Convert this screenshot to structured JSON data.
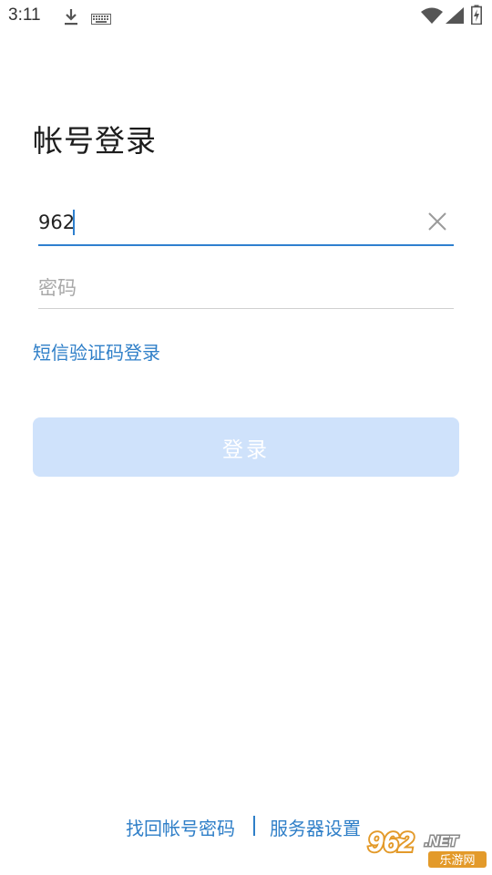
{
  "status_bar": {
    "time": "3:11",
    "icons": [
      "download-icon",
      "keyboard-icon",
      "wifi-icon",
      "signal-icon",
      "battery-charging-icon"
    ]
  },
  "page": {
    "title": "帐号登录"
  },
  "form": {
    "username_value": "962",
    "password_placeholder": "密码",
    "sms_login_label": "短信验证码登录",
    "login_button_label": "登录"
  },
  "footer": {
    "recover_label": "找回帐号密码",
    "divider": "|",
    "server_settings_label": "服务器设置"
  },
  "watermark": {
    "brand": "962.NET",
    "subtitle": "乐游网"
  },
  "colors": {
    "accent": "#2f80cf",
    "link": "#2f7fc8",
    "button_disabled_bg": "#cfe2fb",
    "placeholder": "#a8a8a8"
  }
}
